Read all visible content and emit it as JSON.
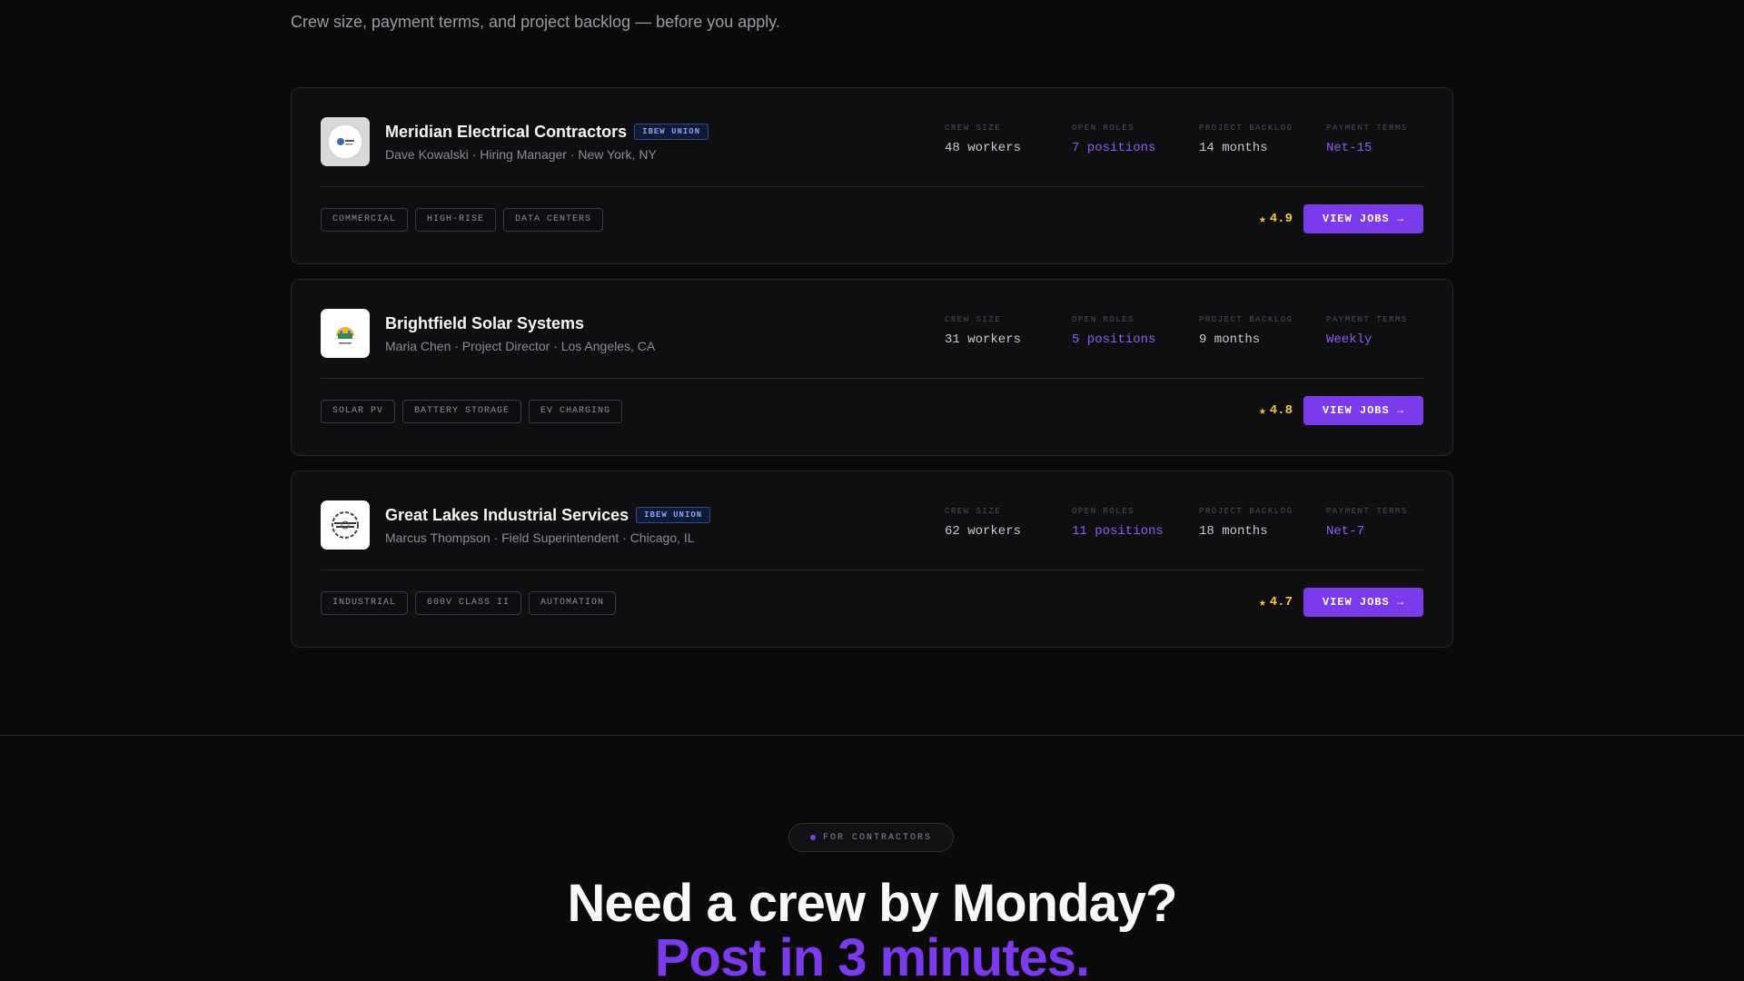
{
  "header": {
    "subtitle": "Crew size, payment terms, and project backlog — before you apply."
  },
  "stat_labels": {
    "crew_size": "CREW SIZE",
    "open_roles": "OPEN ROLES",
    "project_backlog": "PROJECT BACKLOG",
    "payment_terms": "PAYMENT TERMS"
  },
  "contractors": [
    {
      "name": "Meridian Electrical Contractors",
      "badge": "IBEW UNION",
      "contact": "Dave Kowalski · Hiring Manager · New York, NY",
      "crew_size": "48 workers",
      "open_roles": "7 positions",
      "project_backlog": "14 months",
      "payment_terms": "Net-15",
      "tags": [
        "COMMERCIAL",
        "HIGH-RISE",
        "DATA CENTERS"
      ],
      "rating": "4.9",
      "button": "VIEW JOBS →",
      "logo_icon": "meridian-logo"
    },
    {
      "name": "Brightfield Solar Systems",
      "badge": "",
      "contact": "Maria Chen · Project Director · Los Angeles, CA",
      "crew_size": "31 workers",
      "open_roles": "5 positions",
      "project_backlog": "9 months",
      "payment_terms": "Weekly",
      "tags": [
        "SOLAR PV",
        "BATTERY STORAGE",
        "EV CHARGING"
      ],
      "rating": "4.8",
      "button": "VIEW JOBS →",
      "logo_icon": "brightfield-logo"
    },
    {
      "name": "Great Lakes Industrial Services",
      "badge": "IBEW UNION",
      "contact": "Marcus Thompson · Field Superintendent · Chicago, IL",
      "crew_size": "62 workers",
      "open_roles": "11 positions",
      "project_backlog": "18 months",
      "payment_terms": "Net-7",
      "tags": [
        "INDUSTRIAL",
        "600V CLASS II",
        "AUTOMATION"
      ],
      "rating": "4.7",
      "button": "VIEW JOBS →",
      "logo_icon": "great-lakes-logo"
    }
  ],
  "cta": {
    "pill_label": "FOR CONTRACTORS",
    "heading": "Need a crew by Monday?",
    "accent": "Post in 3 minutes."
  },
  "colors": {
    "background": "#0a0a0b",
    "accent": "#7c3aed",
    "star": "#f5c542",
    "union_badge": "#7fa6ff"
  }
}
